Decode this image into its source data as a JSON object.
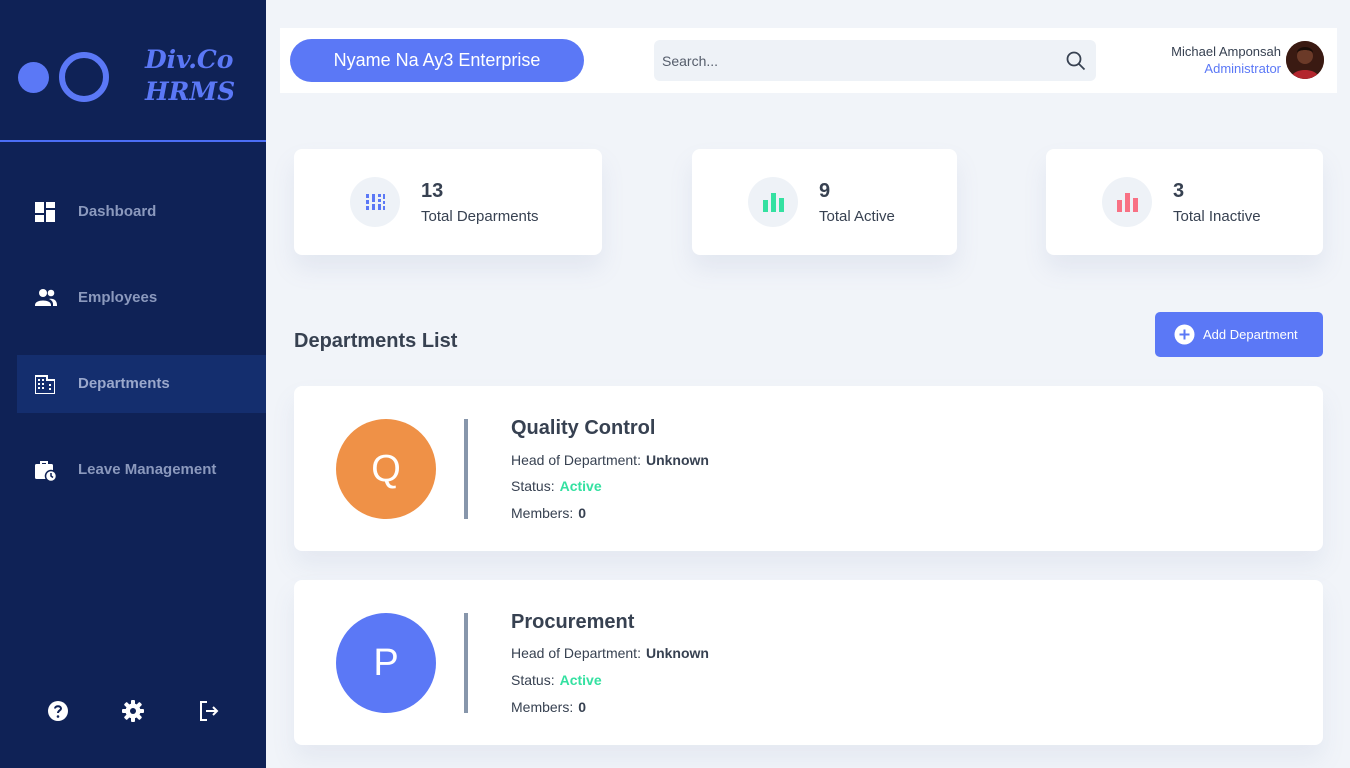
{
  "app": {
    "brand_line1": "Div.Co",
    "brand_line2": "HRMS",
    "accent_color": "#5b78f6",
    "sidebar_color": "#0f2256"
  },
  "sidebar": {
    "items": [
      {
        "label": "Dashboard",
        "icon": "dashboard-grid-icon"
      },
      {
        "label": "Employees",
        "icon": "people-icon"
      },
      {
        "label": "Departments",
        "icon": "building-icon",
        "active": true
      },
      {
        "label": "Leave Management",
        "icon": "briefcase-clock-icon"
      }
    ],
    "bottom_icons": [
      "help-icon",
      "gear-icon",
      "logout-icon"
    ]
  },
  "header": {
    "company": "Nyame Na Ay3 Enterprise",
    "search_placeholder": "Search...",
    "user_name": "Michael Amponsah",
    "user_role": "Administrator"
  },
  "stats": [
    {
      "value": "13",
      "label": "Total Deparments",
      "icon": "barcode-grid-icon",
      "color": "#5b78f6"
    },
    {
      "value": "9",
      "label": "Total Active",
      "icon": "bar-chart-icon",
      "color": "#34e1a1"
    },
    {
      "value": "3",
      "label": "Total Inactive",
      "icon": "bar-chart-icon",
      "color": "#f87184"
    }
  ],
  "departments_section": {
    "title": "Departments List",
    "add_button": "Add Department"
  },
  "field_labels": {
    "head": "Head of Department:",
    "status": "Status:",
    "members": "Members:"
  },
  "departments": [
    {
      "initial": "Q",
      "name": "Quality Control",
      "head": "Unknown",
      "status": "Active",
      "members": "0",
      "color": "#ef9147"
    },
    {
      "initial": "P",
      "name": "Procurement",
      "head": "Unknown",
      "status": "Active",
      "members": "0",
      "color": "#5b78f6"
    }
  ]
}
